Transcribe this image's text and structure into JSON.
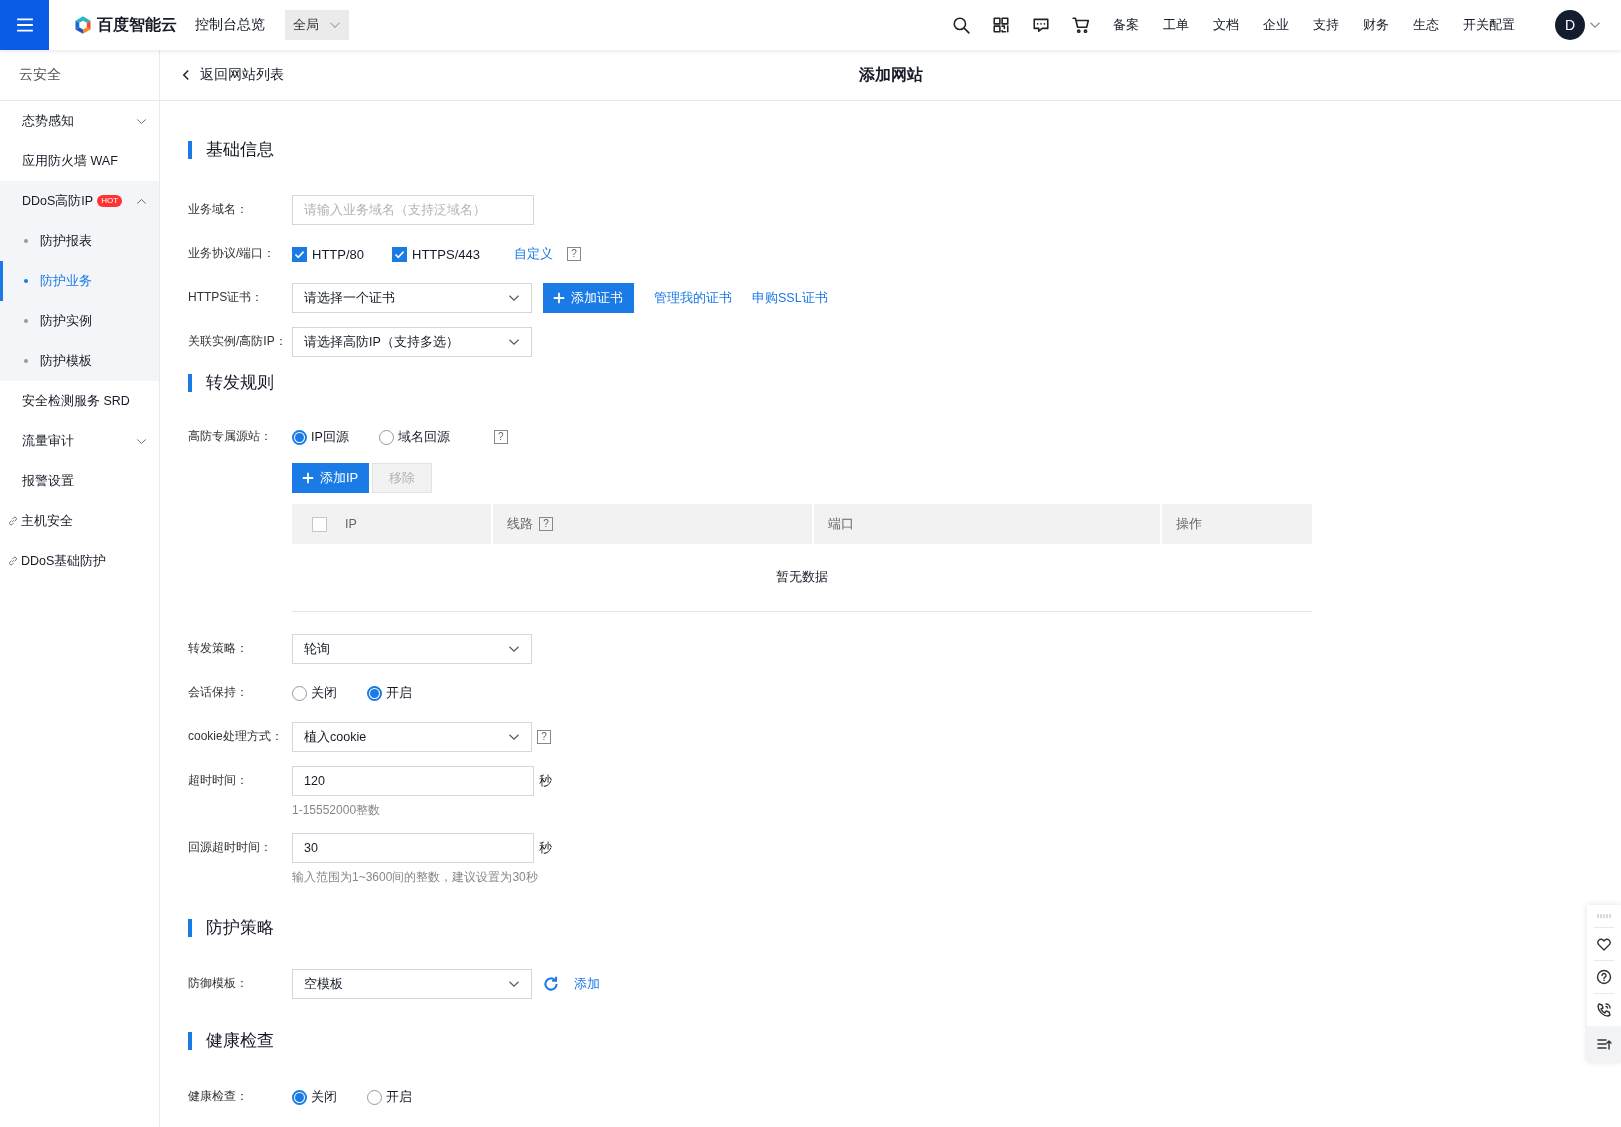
{
  "header": {
    "logo_text": "百度智能云",
    "title": "控制台总览",
    "region": "全局",
    "nav_links": [
      "备案",
      "工单",
      "文档",
      "企业",
      "支持",
      "财务",
      "生态",
      "开关配置"
    ],
    "avatar": "D"
  },
  "sidebar": {
    "title": "云安全",
    "items": [
      {
        "kind": "group",
        "label": "态势感知",
        "expanded": false
      },
      {
        "kind": "item",
        "label": "应用防火墙 WAF"
      },
      {
        "kind": "group",
        "label": "DDoS高防IP",
        "badge": "HOT",
        "expanded": true,
        "children": [
          {
            "label": "防护报表",
            "selected": false
          },
          {
            "label": "防护业务",
            "selected": true
          },
          {
            "label": "防护实例",
            "selected": false
          },
          {
            "label": "防护模板",
            "selected": false
          }
        ]
      },
      {
        "kind": "item",
        "label": "安全检测服务 SRD"
      },
      {
        "kind": "group",
        "label": "流量审计",
        "expanded": false
      },
      {
        "kind": "item",
        "label": "报警设置"
      },
      {
        "kind": "external",
        "label": "主机安全"
      },
      {
        "kind": "external",
        "label": "DDoS基础防护"
      }
    ]
  },
  "page": {
    "back": "返回网站列表",
    "title": "添加网站"
  },
  "sections": [
    {
      "title": "基础信息",
      "fields": [
        {
          "kind": "input",
          "label": "业务域名：",
          "placeholder": "请输入业务域名（支持泛域名）"
        },
        {
          "kind": "checkboxes",
          "label": "业务协议/端口：",
          "options": [
            {
              "label": "HTTP/80",
              "checked": true
            },
            {
              "label": "HTTPS/443",
              "checked": true
            }
          ],
          "link": "自定义",
          "help": "?"
        },
        {
          "kind": "select",
          "label": "HTTPS证书：",
          "value": "请选择一个证书",
          "button": "添加证书",
          "links": [
            "管理我的证书",
            "申购SSL证书"
          ]
        },
        {
          "kind": "select",
          "label": "关联实例/高防IP：",
          "value": "请选择高防IP（支持多选）"
        }
      ]
    },
    {
      "title": "转发规则",
      "fields": [
        {
          "kind": "radios",
          "label": "高防专属源站：",
          "options": [
            {
              "label": "IP回源",
              "selected": true
            },
            {
              "label": "域名回源",
              "selected": false
            }
          ],
          "help": "?"
        },
        {
          "kind": "table",
          "buttons": [
            {
              "label": "添加IP",
              "disabled": false
            },
            {
              "label": "移除",
              "disabled": true
            }
          ],
          "select_all": false,
          "columns": [
            {
              "label": "IP"
            },
            {
              "label": "线路",
              "help": "?"
            },
            {
              "label": "端口"
            },
            {
              "label": "操作"
            }
          ],
          "empty": "暂无数据"
        },
        {
          "kind": "select",
          "label": "转发策略：",
          "value": "轮询"
        },
        {
          "kind": "radios",
          "label": "会话保持：",
          "options": [
            {
              "label": "关闭",
              "selected": false
            },
            {
              "label": "开启",
              "selected": true
            }
          ]
        },
        {
          "kind": "select",
          "label": "cookie处理方式：",
          "value": "植入cookie",
          "help": "?"
        },
        {
          "kind": "input",
          "label": "超时时间：",
          "value": "120",
          "unit": "秒",
          "hint": "1-15552000整数"
        },
        {
          "kind": "input",
          "label": "回源超时时间：",
          "value": "30",
          "unit": "秒",
          "hint": "输入范围为1~3600间的整数，建议设置为30秒"
        }
      ]
    },
    {
      "title": "防护策略",
      "fields": [
        {
          "kind": "select",
          "label": "防御模板：",
          "value": "空模板",
          "refresh": true,
          "link": "添加"
        }
      ]
    },
    {
      "title": "健康检查",
      "fields": [
        {
          "kind": "radios",
          "label": "健康检查：",
          "options": [
            {
              "label": "关闭",
              "selected": true
            },
            {
              "label": "开启",
              "selected": false
            }
          ]
        }
      ]
    }
  ]
}
